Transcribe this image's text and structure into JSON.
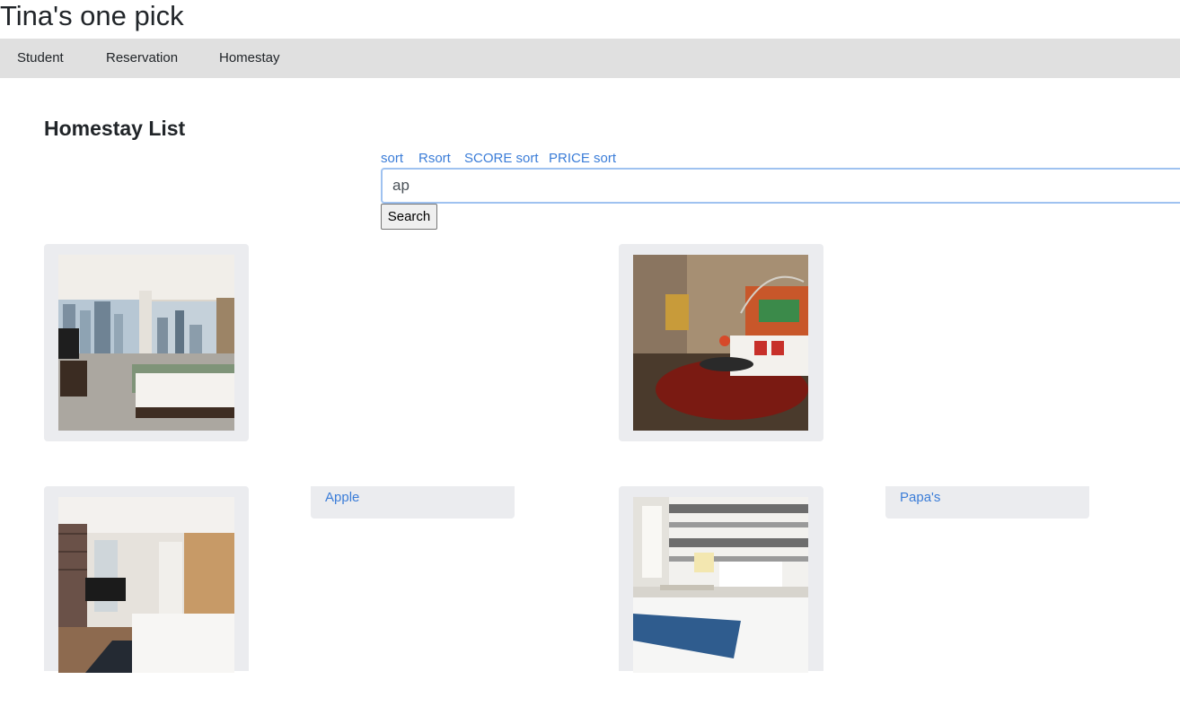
{
  "site": {
    "title": "Tina's one pick"
  },
  "nav": {
    "items": [
      {
        "label": "Student"
      },
      {
        "label": "Reservation"
      },
      {
        "label": "Homestay"
      }
    ]
  },
  "page": {
    "heading": "Homestay List"
  },
  "sort_links": [
    {
      "label": "sort"
    },
    {
      "label": "Rsort"
    },
    {
      "label": "SCORE sort"
    },
    {
      "label": "PRICE sort"
    }
  ],
  "search": {
    "value": "ap",
    "button_label": "Search"
  },
  "homestays": [
    {
      "image": "bedroom-city-view-photo",
      "name": ""
    },
    {
      "image": "living-room-photo",
      "name": ""
    },
    {
      "image": "brick-wall-bedroom-photo",
      "name": "Apple"
    },
    {
      "image": "striped-wall-bedroom-photo",
      "name": "Papa's"
    }
  ]
}
